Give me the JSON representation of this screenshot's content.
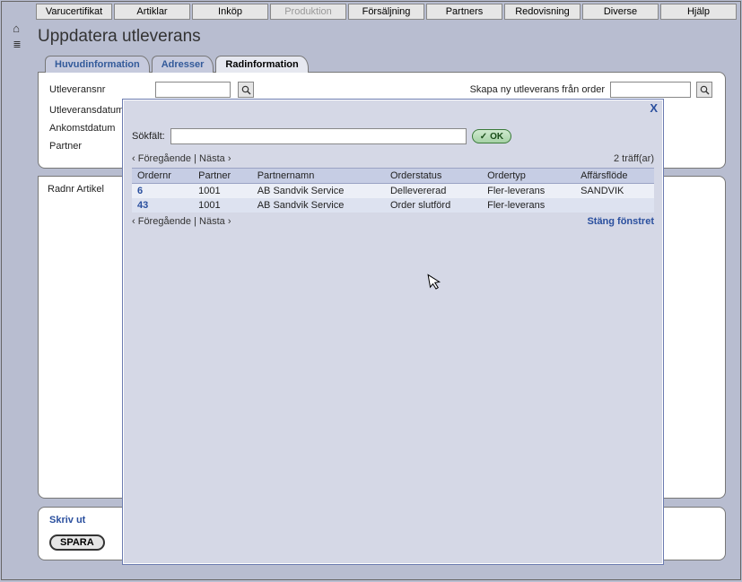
{
  "topnav": {
    "items": [
      {
        "label": "Varucertifikat",
        "disabled": false
      },
      {
        "label": "Artiklar",
        "disabled": false
      },
      {
        "label": "Inköp",
        "disabled": false
      },
      {
        "label": "Produktion",
        "disabled": true
      },
      {
        "label": "Försäljning",
        "disabled": false
      },
      {
        "label": "Partners",
        "disabled": false
      },
      {
        "label": "Redovisning",
        "disabled": false
      },
      {
        "label": "Diverse",
        "disabled": false
      },
      {
        "label": "Hjälp",
        "disabled": false
      }
    ]
  },
  "page": {
    "title": "Uppdatera utleverans"
  },
  "tabs": [
    {
      "label": "Huvudinformation",
      "active": false
    },
    {
      "label": "Adresser",
      "active": false
    },
    {
      "label": "Radinformation",
      "active": true
    }
  ],
  "form": {
    "utleveransnr_label": "Utleveransnr",
    "utleveransdatum_label": "Utleveransdatum",
    "ankomstdatum_label": "Ankomstdatum",
    "partner_label": "Partner",
    "scan_label": "Skapa ny utleverans från order"
  },
  "second_panel": {
    "header": "Radnr Artikel"
  },
  "footer": {
    "print_label": "Skriv ut",
    "save_label": "SPARA"
  },
  "modal": {
    "close": "X",
    "search_label": "Sökfält:",
    "ok_label": "OK",
    "prev_label": "‹ Föregående",
    "next_label": "Nästa ›",
    "sep": " | ",
    "result_count": "2 träff(ar)",
    "columns": [
      "Ordernr",
      "Partner",
      "Partnernamn",
      "Orderstatus",
      "Ordertyp",
      "Affärsflöde"
    ],
    "rows": [
      {
        "ordernr": "6",
        "partner": "1001",
        "partnernamn": "AB Sandvik Service",
        "orderstatus": "Dellevererad",
        "ordertyp": "Fler-leverans",
        "affarsflode": "SANDVIK"
      },
      {
        "ordernr": "43",
        "partner": "1001",
        "partnernamn": "AB Sandvik Service",
        "orderstatus": "Order slutförd",
        "ordertyp": "Fler-leverans",
        "affarsflode": ""
      }
    ],
    "close_window": "Stäng fönstret"
  }
}
